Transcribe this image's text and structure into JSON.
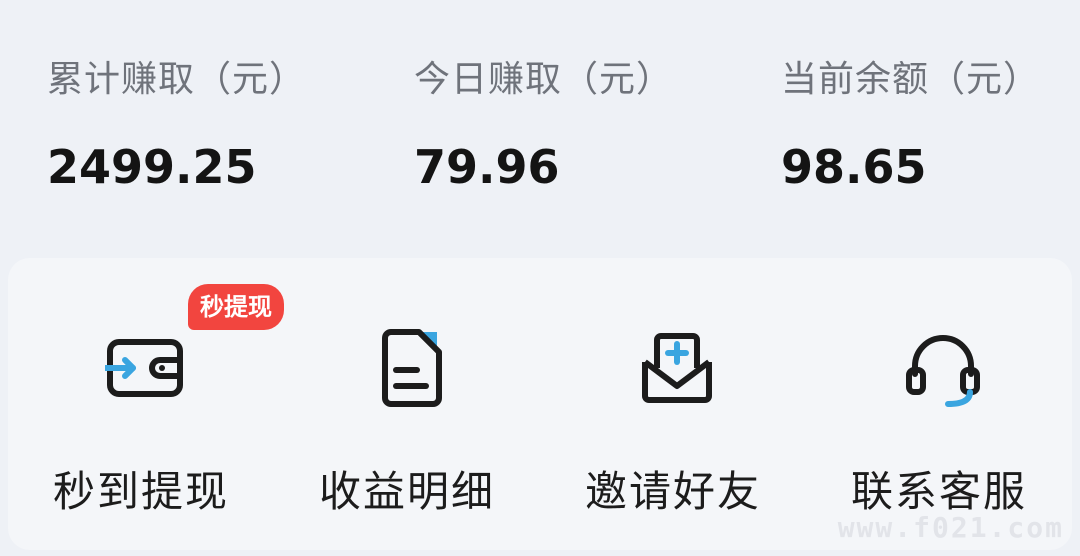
{
  "stats": [
    {
      "label": "累计赚取（元）",
      "value": "2499.25"
    },
    {
      "label": "今日赚取（元）",
      "value": "79.96"
    },
    {
      "label": "当前余额（元）",
      "value": "98.65"
    }
  ],
  "actions": [
    {
      "label": "秒到提现",
      "icon": "wallet-withdraw-icon",
      "badge": "秒提现"
    },
    {
      "label": "收益明细",
      "icon": "document-icon"
    },
    {
      "label": "邀请好友",
      "icon": "invite-envelope-icon"
    },
    {
      "label": "联系客服",
      "icon": "headset-icon"
    }
  ],
  "watermark": "www.f021.com",
  "colors": {
    "accent": "#3aa5e0",
    "badge": "#f2453f",
    "icon": "#1c1c1c"
  }
}
